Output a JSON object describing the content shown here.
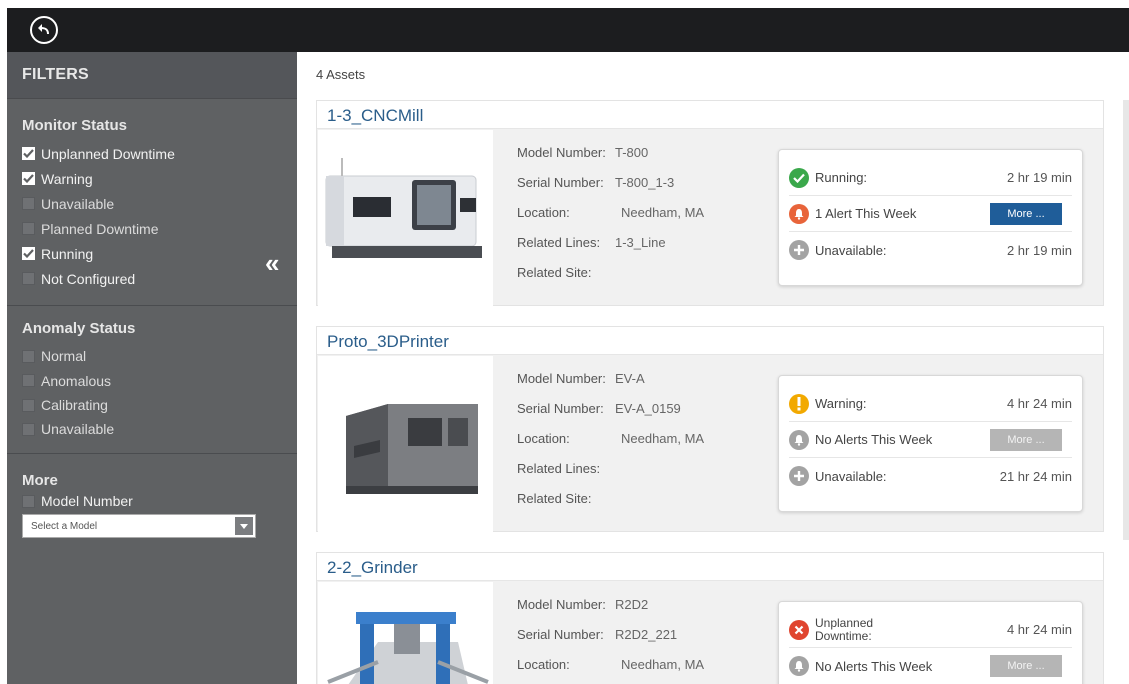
{
  "sidebar": {
    "title": "FILTERS",
    "monitor_status": {
      "title": "Monitor Status",
      "items": [
        {
          "label": "Unplanned Downtime",
          "checked": true
        },
        {
          "label": "Warning",
          "checked": true
        },
        {
          "label": "Unavailable",
          "checked": false
        },
        {
          "label": "Planned Downtime",
          "checked": false
        },
        {
          "label": "Running",
          "checked": true
        },
        {
          "label": "Not Configured",
          "checked": false
        }
      ]
    },
    "anomaly_status": {
      "title": "Anomaly Status",
      "items": [
        {
          "label": "Normal",
          "checked": false
        },
        {
          "label": "Anomalous",
          "checked": false
        },
        {
          "label": "Calibrating",
          "checked": false
        },
        {
          "label": "Unavailable",
          "checked": false
        }
      ]
    },
    "more": {
      "title": "More",
      "model_number_label": "Model Number",
      "select_placeholder": "Select a Model"
    },
    "collapse_glyph": "«"
  },
  "main": {
    "assets_count": "4 Assets",
    "labels": {
      "model_number": "Model Number:",
      "serial_number": "Serial Number:",
      "location": "Location:",
      "related_lines": "Related Lines:",
      "related_site": "Related Site:"
    },
    "assets": [
      {
        "name": "1-3_CNCMill",
        "model_number": "T-800",
        "serial_number": "T-800_1-3",
        "location": "Needham, MA",
        "related_lines": "1-3_Line",
        "related_site": "",
        "status": {
          "label": "Running:",
          "time": "2 hr 19 min",
          "color": "#3aa84b"
        },
        "alerts": {
          "label": "1 Alert This Week",
          "more": "More ...",
          "active": true
        },
        "unavailable": {
          "label": "Unavailable:",
          "time": "2 hr 19 min"
        }
      },
      {
        "name": "Proto_3DPrinter",
        "model_number": "EV-A",
        "serial_number": "EV-A_0159",
        "location": "Needham, MA",
        "related_lines": "",
        "related_site": "",
        "status": {
          "label": "Warning:",
          "time": "4 hr 24 min",
          "color": "#f2a900"
        },
        "alerts": {
          "label": "No Alerts This Week",
          "more": "More ...",
          "active": false
        },
        "unavailable": {
          "label": "Unavailable:",
          "time": "21 hr 24 min"
        }
      },
      {
        "name": "2-2_Grinder",
        "model_number": "R2D2",
        "serial_number": "R2D2_221",
        "location": "Needham, MA",
        "related_lines": "",
        "related_site": "",
        "status": {
          "label_line1": "Unplanned",
          "label_line2": "Downtime:",
          "time": "4 hr 24 min",
          "color": "#e0452f"
        },
        "alerts": {
          "label": "No Alerts This Week",
          "more": "More ...",
          "active": false
        }
      }
    ]
  },
  "colors": {
    "topbar": "#1c1d1f",
    "sidebar": "#5f6163",
    "title_blue": "#2a5d8a",
    "more_active": "#1f5d99",
    "alert_orange": "#e8643a",
    "gray_icon": "#a3a3a3"
  }
}
